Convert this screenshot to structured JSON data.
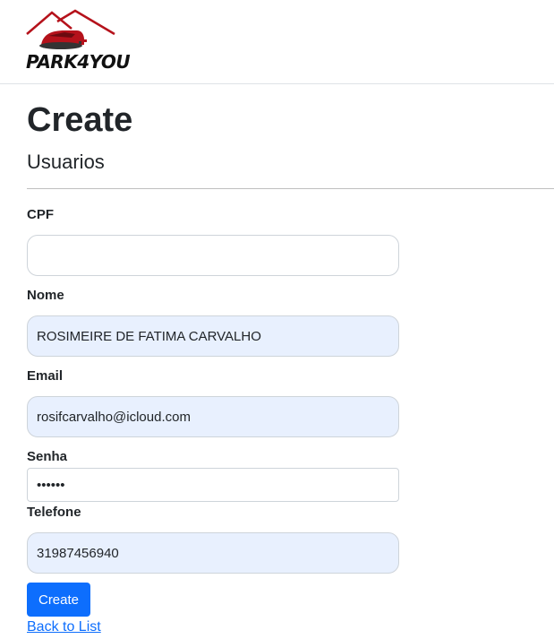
{
  "brand": {
    "name": "PARK4YOU"
  },
  "page": {
    "title": "Create",
    "subtitle": "Usuarios"
  },
  "form": {
    "cpf": {
      "label": "CPF",
      "value": ""
    },
    "nome": {
      "label": "Nome",
      "value": "ROSIMEIRE DE FATIMA CARVALHO"
    },
    "email": {
      "label": "Email",
      "value": "rosifcarvalho@icloud.com"
    },
    "senha": {
      "label": "Senha",
      "value": "••••••"
    },
    "telefone": {
      "label": "Telefone",
      "value": "31987456940"
    },
    "submit_label": "Create"
  },
  "links": {
    "back": "Back to List"
  },
  "colors": {
    "primary": "#0d6efd",
    "autofill_bg": "#e8f0fe",
    "brand_red": "#b5121b"
  }
}
